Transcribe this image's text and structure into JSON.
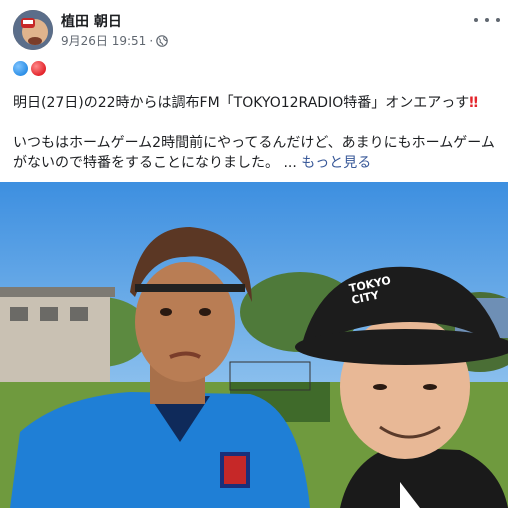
{
  "post": {
    "author": "植田 朝日",
    "date": "9月26日 19:51",
    "separator": "·",
    "emoji_row": [
      "blue-circle",
      "red-circle"
    ],
    "para1": "明日(27日)の22時からは調布FM「TOKYO12RADIO特番」オンエアっす",
    "para1_emoji": "‼",
    "para2_line1": "いつもはホームゲーム2時間前にやってるんだけど、あまりにもホームゲーム",
    "para2_line2": "がないので特番をすることになりました。",
    "ellipsis": "...",
    "see_more": "もっと見る",
    "cap_text": "TOKYO CITY",
    "colors": {
      "link": "#385898",
      "meta": "#606770",
      "text": "#1c1e21"
    }
  }
}
